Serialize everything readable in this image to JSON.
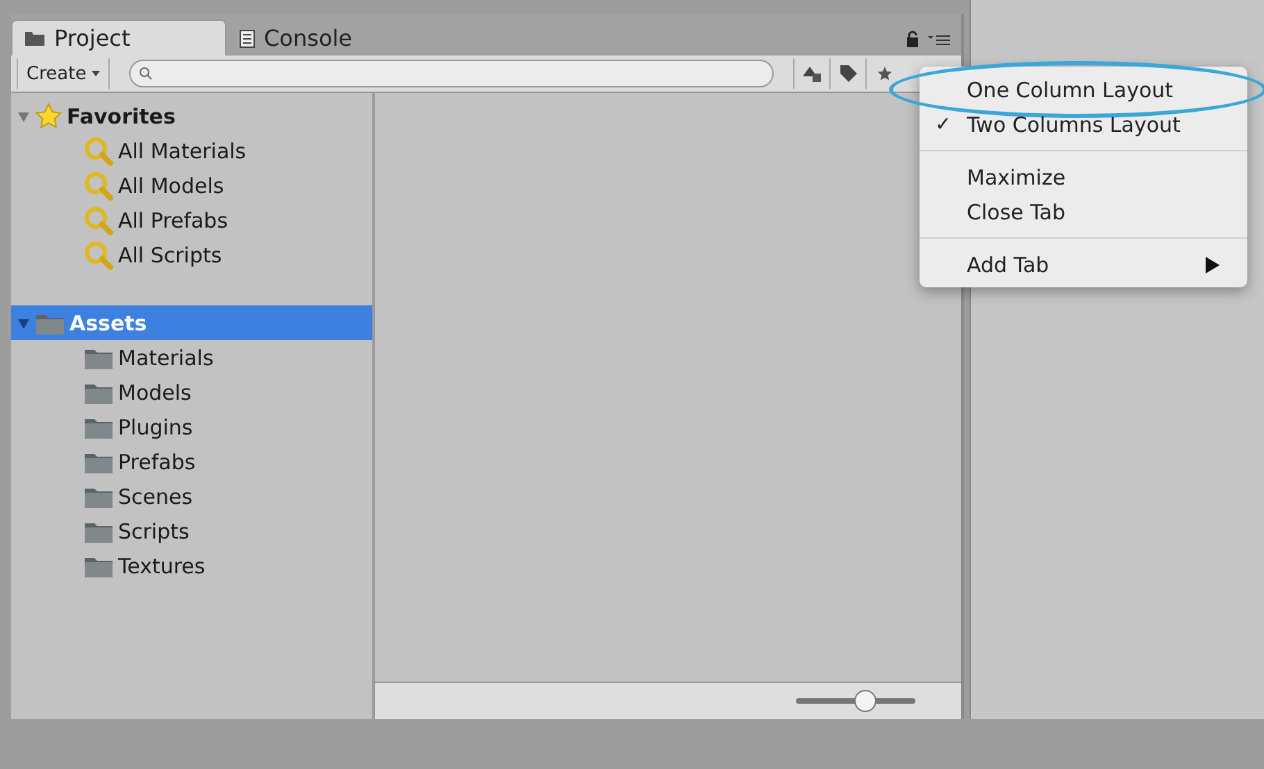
{
  "tabs": [
    {
      "label": "Project",
      "selected": true
    },
    {
      "label": "Console",
      "selected": false
    }
  ],
  "toolbar": {
    "create": "Create"
  },
  "tree": [
    {
      "label": "Favorites",
      "kind": "favorites",
      "expanded": true,
      "selected": false,
      "children": [
        {
          "label": "All Materials",
          "kind": "search",
          "selected": false
        },
        {
          "label": "All Models",
          "kind": "search",
          "selected": false
        },
        {
          "label": "All Prefabs",
          "kind": "search",
          "selected": false
        },
        {
          "label": "All Scripts",
          "kind": "search",
          "selected": false
        }
      ]
    },
    {
      "label": "Assets",
      "kind": "folder",
      "expanded": true,
      "selected": true,
      "children": [
        {
          "label": "Materials",
          "kind": "folder",
          "selected": false
        },
        {
          "label": "Models",
          "kind": "folder",
          "selected": false
        },
        {
          "label": "Plugins",
          "kind": "folder",
          "selected": false
        },
        {
          "label": "Prefabs",
          "kind": "folder",
          "selected": false
        },
        {
          "label": "Scenes",
          "kind": "folder",
          "selected": false
        },
        {
          "label": "Scripts",
          "kind": "folder",
          "selected": false
        },
        {
          "label": "Textures",
          "kind": "folder",
          "selected": false
        }
      ]
    }
  ],
  "zoom_slider": {
    "level": 0.58
  },
  "menu": {
    "check_mark": "✓",
    "groups": [
      [
        {
          "label": "One Column Layout",
          "checked": false,
          "submenu": false,
          "highlighted": true
        },
        {
          "label": "Two Columns Layout",
          "checked": true,
          "submenu": false,
          "highlighted": false
        }
      ],
      [
        {
          "label": "Maximize",
          "checked": false,
          "submenu": false,
          "highlighted": false
        },
        {
          "label": "Close Tab",
          "checked": false,
          "submenu": false,
          "highlighted": false
        }
      ],
      [
        {
          "label": "Add Tab",
          "checked": false,
          "submenu": true,
          "highlighted": false
        }
      ]
    ]
  }
}
